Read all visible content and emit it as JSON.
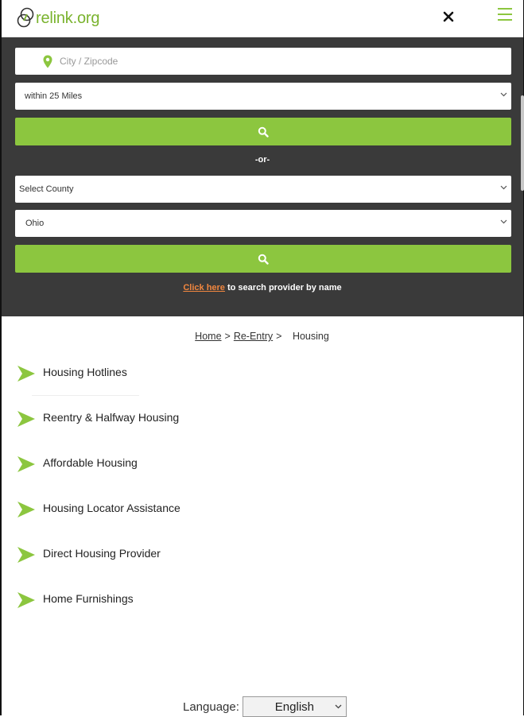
{
  "header": {
    "logo_text": "relink.org",
    "close_icon": "close-icon",
    "menu_icon": "hamburger-menu-icon"
  },
  "search": {
    "location_placeholder": "City / Zipcode",
    "location_value": "",
    "radius_selected": "within 25 Miles",
    "or_label": "-or-",
    "county_selected": "Select County",
    "state_selected": "Ohio",
    "provider_link_label": "Click here",
    "provider_suffix": " to search provider by name"
  },
  "breadcrumb": {
    "home": "Home",
    "sep": ">",
    "reentry": "Re-Entry",
    "current": "Housing"
  },
  "categories": [
    {
      "label": "Housing Hotlines"
    },
    {
      "label": "Reentry & Halfway Housing"
    },
    {
      "label": "Affordable Housing"
    },
    {
      "label": "Housing Locator Assistance"
    },
    {
      "label": "Direct Housing Provider"
    },
    {
      "label": "Home Furnishings"
    }
  ],
  "language": {
    "label": "Language:",
    "selected": "English"
  },
  "colors": {
    "accent_green": "#8cc63f",
    "panel_dark": "#3a3a3a",
    "link_orange": "#f0863f"
  }
}
